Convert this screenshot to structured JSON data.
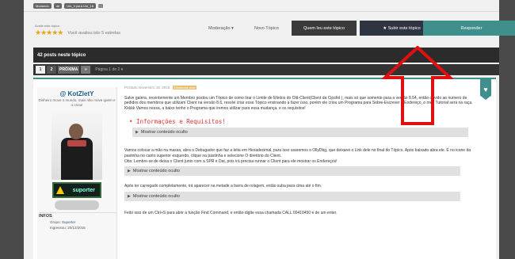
{
  "tags": [
    "Mudando",
    "de",
    "Um_3 para Um_16"
  ],
  "rating": {
    "label": "Avalie este tópico",
    "stars": "★★★★★",
    "value": 5,
    "your_rating": "Você avaliou isto 5 estrelas"
  },
  "actions": {
    "moderation": "Moderação ▾",
    "new_topic": "Novo Tópico",
    "who_read": "Quem leu este tópico",
    "follow": "★ Subir este tópico",
    "reply": "Responder"
  },
  "topic": {
    "posts_count": "42 posts neste tópico"
  },
  "pagination": {
    "pages": [
      "1",
      "2"
    ],
    "next": "PRÓXIMA",
    "last": "»",
    "info": "Página 1 de 2 ▾"
  },
  "post": {
    "author": "@ KotZletY",
    "author_title": "Dinheiro move o mundo, mais não move quem e o criou!",
    "badge_label": "suporter",
    "infos_heading": "INFOS",
    "group_label": "Grupo:",
    "group_value": "Suporter",
    "joined_label": "Ingressou: 20/12/2015",
    "meta_date": "Postado Novembro 18, 2016",
    "meta_report": "Denunciar post",
    "body1": "Salve galera, recentemente um Membro postou um Tópico de como tirar o Limite de Efeitos do Old-Client(Client da Cipsfot ), mais só que somente para a versão 8.54, então devido ao numero de pedidos dos membros que utilizam Client na versão 8.6, resolvi criar esse Tópico ensinando a fazer isso, porém ele criou um Programa para Sobre-Escrever o Endereço, o meu Tutorial será na raça. Kkkkk Vamos nessa, a baixo tenho o Programa que iremos utilizar para essa mudança, e os requisitos!",
    "section_title": "• Informações e Requisitos!",
    "spoiler_label": "Mostrar conteúdo oculto",
    "body2": "Vamos colocar a mão na massa, abra o Debugador que faz a leita em Hexadecimal, para isso usaremos o OllyDbg, que deixarei o Link dele no final do Tópico. Após baixado abra ele. É no icone da pastinha no canto superior esquerdo, clique na pastinha e selecione O diretório do Client.",
    "body3": "Obs: Lembre-se de deixa o Client junto com a SPR e Dat, pois irá precisa runnar o Client para ele mostrar os Endereços!",
    "body4": "Após ter carregado completamente, irá aparecer na metade a barra de rolagem, então suba para cima até o fim.",
    "body5": "Feito isso de um Ctrl+S para abrir a função Find Command, e então digite essa chamada CALL 00410450 e de um enter."
  },
  "colors": {
    "accent": "#3f8f8c",
    "header": "#2b2b2b",
    "star": "#e8a317",
    "annotation": "#e01010"
  }
}
